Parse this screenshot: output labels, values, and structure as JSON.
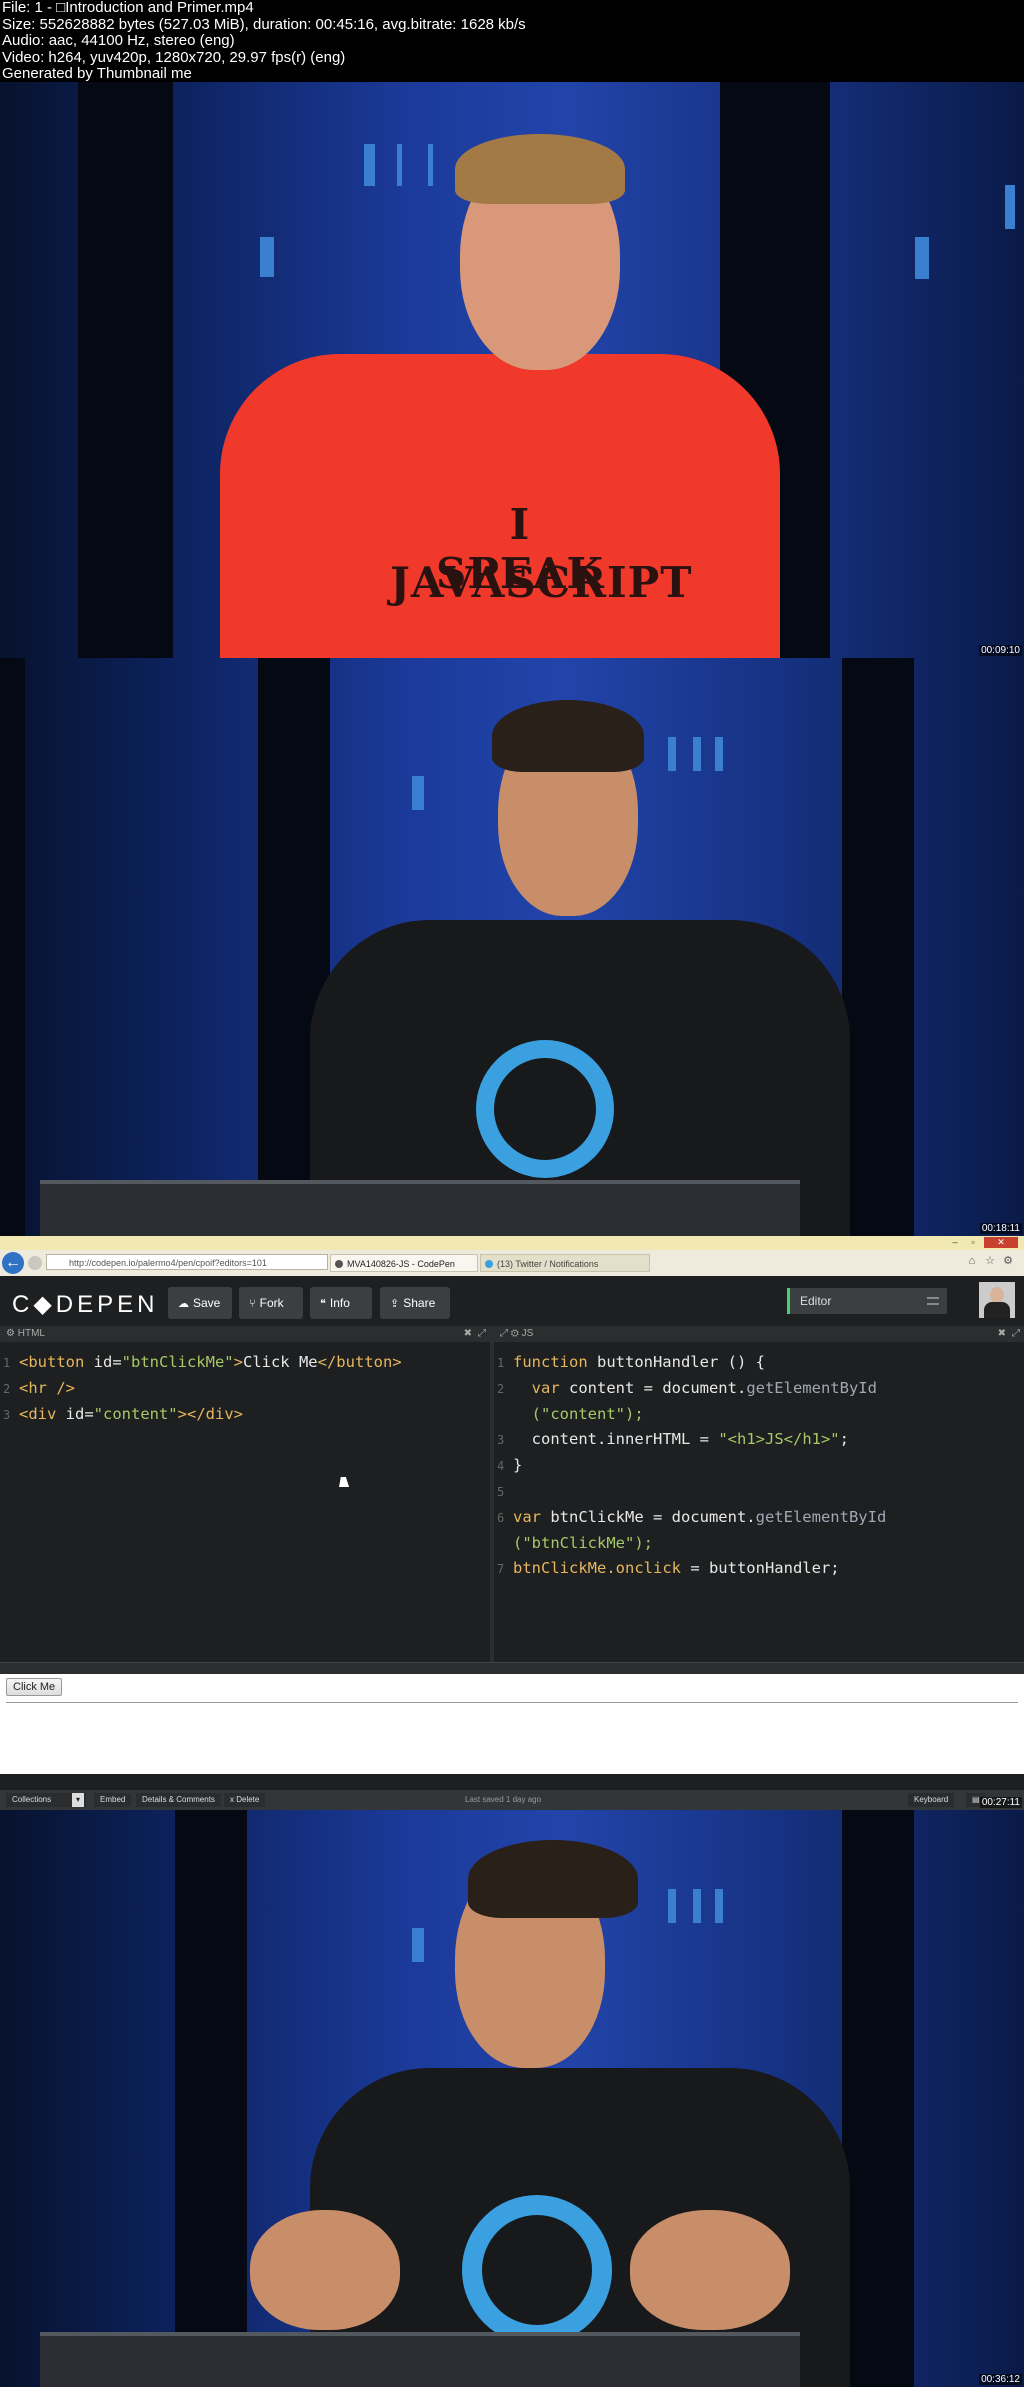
{
  "header": {
    "line1": "File: 1 - □Introduction and Primer.mp4",
    "line2": "Size: 552628882 bytes (527.03 MiB), duration: 00:45:16, avg.bitrate: 1628 kb/s",
    "line3": "Audio: aac, 44100 Hz, stereo (eng)",
    "line4": "Video: h264, yuv420p, 1280x720, 29.97 fps(r) (eng)",
    "line5": "Generated by Thumbnail me"
  },
  "frames": [
    {
      "timestamp": "00:09:10",
      "shirt_text_1": "I SPEAK",
      "shirt_text_2": "JAVASCRIPT"
    },
    {
      "timestamp": "00:18:11"
    },
    {
      "timestamp": "00:27:11"
    },
    {
      "timestamp": "00:36:12"
    }
  ],
  "browser": {
    "address": "http://codepen.io/palermo4/pen/cpoif?editors=101",
    "tab_active": "MVA140826-JS - CodePen",
    "tab_other": "(13) Twitter / Notifications"
  },
  "codepen": {
    "logo": "C◆DEPEN",
    "buttons": {
      "save": "Save",
      "fork": "Fork",
      "info": "Info",
      "share": "Share"
    },
    "editor_select": "Editor",
    "html_pane_label": "HTML",
    "js_pane_label": "JS",
    "html_lines": [
      {
        "n": "1",
        "tag_open": "<button",
        "attr": " id=",
        "str": "\"btnClickMe\"",
        "tag_close": ">",
        "text": "Click Me",
        "end_tag": "</button>"
      },
      {
        "n": "2",
        "tag_open": "<hr />"
      },
      {
        "n": "3",
        "tag_open": "<div",
        "attr": " id=",
        "str": "\"content\"",
        "tag_close": "></div>"
      }
    ],
    "js_lines": {
      "l1_n": "1",
      "l1_kw": "function",
      "l1_fn": " buttonHandler () {",
      "l2_n": "2",
      "l2_kw": "  var",
      "l2_rest": " content = document.",
      "l2_mth": "getElementById",
      "l2b": "  (\"content\");",
      "l3_n": "3",
      "l3_a": "  content.",
      "l3_b": "innerHTML",
      "l3_c": " = ",
      "l3_str": "\"<h1>JS</h1>\"",
      "l3_d": ";",
      "l4_n": "4",
      "l4": "}",
      "l5_n": "5",
      "l6_n": "6",
      "l6_kw": "var",
      "l6_rest": " btnClickMe = document.",
      "l6_mth": "getElementById",
      "l6b_str": "(\"btnClickMe\");",
      "l7_n": "7",
      "l7_a": "btnClickMe.",
      "l7_b": "onclick",
      "l7_c": " = buttonHandler;"
    },
    "preview_button": "Click Me",
    "footer": {
      "collections": "Collections",
      "embed": "Embed",
      "details": "Details & Comments",
      "delete": "x Delete",
      "saved": "Last saved 1 day ago",
      "keyboard": "Keyboard"
    }
  },
  "colors": {
    "accent": "#47cf73",
    "backdrop": "#1b3a9a",
    "red_shirt": "#f0392a"
  }
}
